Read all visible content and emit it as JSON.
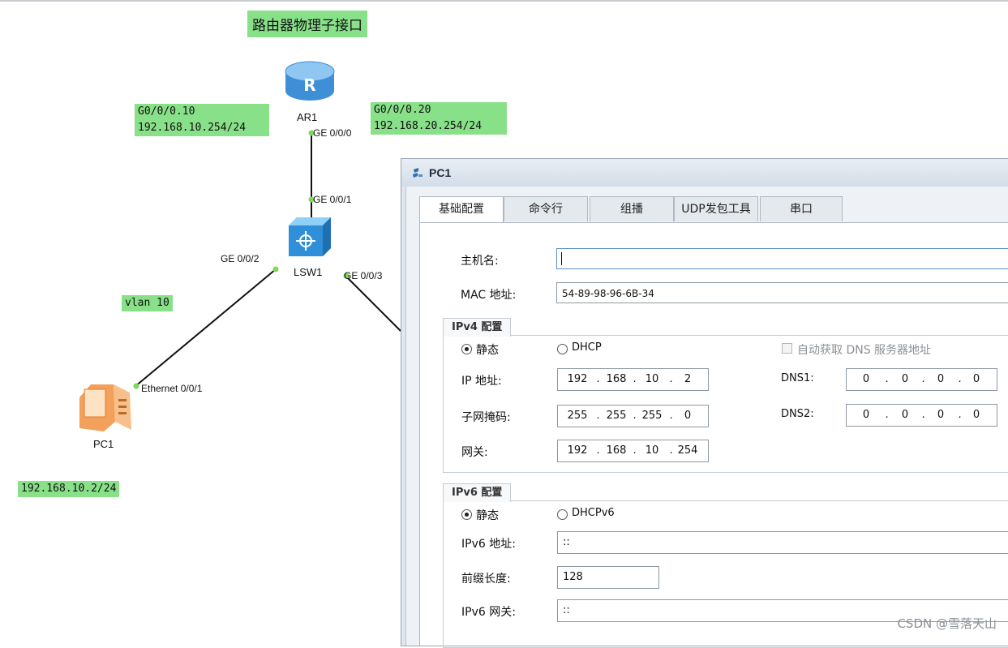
{
  "topology": {
    "title": "路由器物理子接口",
    "devices": {
      "router": "AR1",
      "switch": "LSW1",
      "pc": "PC1"
    },
    "labels": {
      "ar1_sub10_if": "G0/0/0.10",
      "ar1_sub10_ip": "192.168.10.254/24",
      "ar1_sub20_if": "G0/0/0.20",
      "ar1_sub20_ip": "192.168.20.254/24",
      "vlan": "vlan 10",
      "pc_ip": "192.168.10.2/24"
    },
    "ports": {
      "ar1_ge000": "GE 0/0/0",
      "lsw_ge001": "GE 0/0/1",
      "lsw_ge002": "GE 0/0/2",
      "lsw_ge003": "GE 0/0/3",
      "pc_eth": "Ethernet 0/0/1"
    }
  },
  "window": {
    "title": "PC1",
    "tabs": [
      "基础配置",
      "命令行",
      "组播",
      "UDP发包工具",
      "串口"
    ],
    "active_tab": "基础配置",
    "hostname_label": "主机名:",
    "hostname_value": "",
    "mac_label": "MAC 地址:",
    "mac_value": "54-89-98-96-6B-34",
    "ipv4": {
      "group_title": "IPv4 配置",
      "static_label": "静态",
      "dhcp_label": "DHCP",
      "mode": "static",
      "auto_dns_label": "自动获取 DNS 服务器地址",
      "ip_label": "IP 地址:",
      "ip": [
        "192",
        "168",
        "10",
        "2"
      ],
      "mask_label": "子网掩码:",
      "mask": [
        "255",
        "255",
        "255",
        "0"
      ],
      "gateway_label": "网关:",
      "gateway": [
        "192",
        "168",
        "10",
        "254"
      ],
      "dns1_label": "DNS1:",
      "dns1": [
        "0",
        "0",
        "0",
        "0"
      ],
      "dns2_label": "DNS2:",
      "dns2": [
        "0",
        "0",
        "0",
        "0"
      ]
    },
    "ipv6": {
      "group_title": "IPv6 配置",
      "static_label": "静态",
      "dhcp_label": "DHCPv6",
      "mode": "static",
      "addr_label": "IPv6 地址:",
      "addr": "::",
      "prefix_label": "前缀长度:",
      "prefix": "128",
      "gw_label": "IPv6 网关:",
      "gw": "::"
    }
  },
  "watermark": "CSDN @雪落天山",
  "colors": {
    "label_green": "#88e088",
    "link_dot": "#7ed957",
    "window_bg": "#dfe6ee"
  }
}
